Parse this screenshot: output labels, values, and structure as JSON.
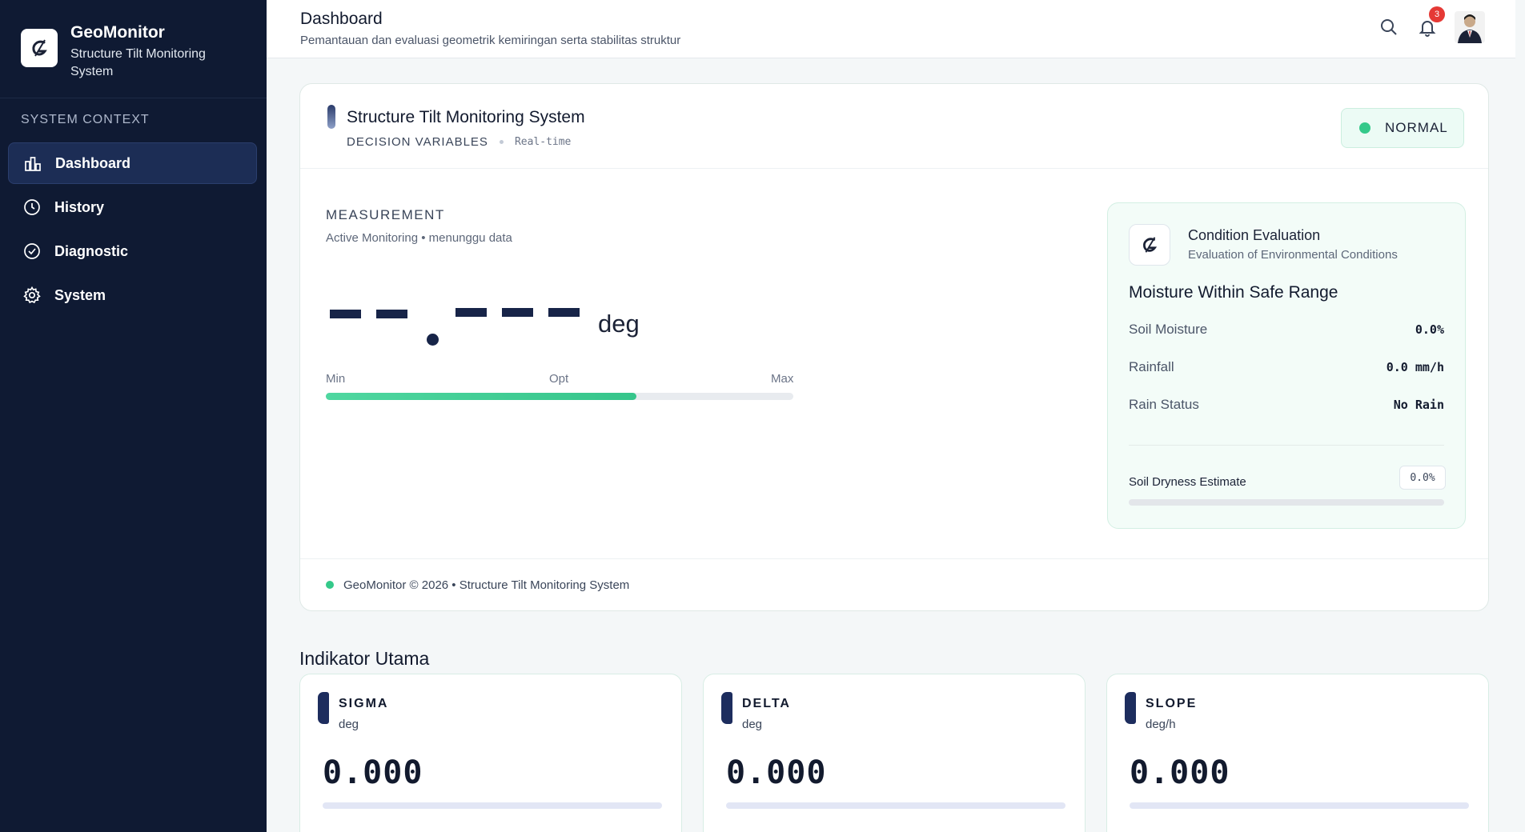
{
  "sidebar": {
    "brand_name": "GeoMonitor",
    "brand_sub": "Structure Tilt Monitoring System",
    "section_label": "SYSTEM CONTEXT",
    "items": [
      {
        "label": "Dashboard",
        "icon": "bar-chart-icon",
        "active": true
      },
      {
        "label": "History",
        "icon": "clock-icon",
        "active": false
      },
      {
        "label": "Diagnostic",
        "icon": "check-circle-icon",
        "active": false
      },
      {
        "label": "System",
        "icon": "gear-icon",
        "active": false
      }
    ]
  },
  "header": {
    "title": "Dashboard",
    "subtitle": "Pemantauan dan evaluasi geometrik kemiringan serta stabilitas struktur",
    "notification_count": "3",
    "icons": [
      "search-icon",
      "bell-icon",
      "avatar"
    ]
  },
  "main": {
    "title": "Structure Tilt Monitoring System",
    "meta_label": "DECISION VARIABLES",
    "meta_mode": "Real-time",
    "status": "NORMAL",
    "status_color": "#34c98a",
    "measurement_label": "MEASUREMENT",
    "measurement_sub": "Active Monitoring • menunggu data",
    "unit": "deg",
    "range_min": "Min",
    "range_opt": "Opt",
    "range_max": "Max",
    "range_fill": 0.665,
    "footer": "GeoMonitor © 2026 • Structure Tilt Monitoring System"
  },
  "evaluation": {
    "title": "Condition Evaluation",
    "subtitle": "Evaluation of Environmental Conditions",
    "status": "Moisture Within Safe Range",
    "rows": [
      {
        "label": "Soil Moisture",
        "value": "0.0%"
      },
      {
        "label": "Rainfall",
        "value": "0.0 mm/h"
      },
      {
        "label": "Rain Status",
        "value": "No Rain"
      }
    ],
    "dryness_label": "Soil Dryness Estimate",
    "dryness_value": "0.0%",
    "dryness_fill": 0.0
  },
  "indicators": {
    "title": "Indikator Utama",
    "cards": [
      {
        "name": "SIGMA",
        "unit": "deg",
        "value": "0.000"
      },
      {
        "name": "DELTA",
        "unit": "deg",
        "value": "0.000"
      },
      {
        "name": "SLOPE",
        "unit": "deg/h",
        "value": "0.000"
      }
    ]
  }
}
